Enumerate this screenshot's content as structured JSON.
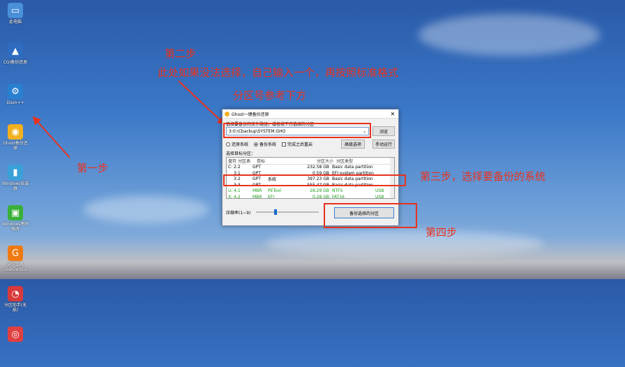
{
  "desktop_icons": [
    {
      "label": "此电脑",
      "icon": "computer-icon",
      "color": "#4a90d9"
    },
    {
      "label": "CGI备份还原",
      "icon": "cgi-icon",
      "color": "#2d6cc0"
    },
    {
      "label": "Dism++",
      "icon": "gear-icon",
      "color": "#2a80d0"
    },
    {
      "label": "Ghost备份还原",
      "icon": "ghost-icon",
      "color": "#f2b01e"
    },
    {
      "label": "Windows安装器",
      "icon": "installer-icon",
      "color": "#3aa0d8"
    },
    {
      "label": "Windows密码修改",
      "icon": "lock-icon",
      "color": "#3ab03a"
    },
    {
      "label": "分区工具DiskGenius",
      "icon": "diskgenius-icon",
      "color": "#f07a10"
    },
    {
      "label": "分区助手(无损)",
      "icon": "partition-icon",
      "color": "#d83a3a"
    },
    {
      "label": "",
      "icon": "lifebuoy-icon",
      "color": "#e04040"
    }
  ],
  "annotations": {
    "step2": "第二步",
    "step2_line1": "此处如果没法选择，自己输入一个，再按照标准格式",
    "step2_line2": "分区号参考下方",
    "step1": "第一步",
    "step3": "第三步，选择要备份的系统",
    "step4": "第四步"
  },
  "dialog": {
    "title": "Ghost一键备份还原",
    "path_label": "选择要备份的文件路径，或者按下方选择的分区",
    "path_value": "3:0:\\Cbackup\\SYSTEM.GHO",
    "browse": "浏览",
    "radio_restore": "还原系统",
    "radio_backup": "备份系统",
    "checkbox_reboot": "完成之后重启",
    "advanced": "高级选项",
    "manual": "手动运行",
    "target_label": "选择目标分区：",
    "columns": [
      "盘符",
      "分区表",
      "卷标",
      "",
      "分区大小",
      "分区类型",
      ""
    ],
    "rows": [
      {
        "drive": "C:",
        "part": "2:2",
        "table": "GPT",
        "label": "",
        "size": "232.58 GB",
        "type": "Basic data partition",
        "bus": "",
        "green": false
      },
      {
        "drive": "",
        "part": "3:1",
        "table": "GPT",
        "label": "",
        "size": "0.59 GB",
        "type": "EFI system partition",
        "bus": "",
        "green": false
      },
      {
        "drive": "",
        "part": "3:2",
        "table": "GPT",
        "label": "系统",
        "size": "397.23 GB",
        "type": "Basic data partition",
        "bus": "",
        "green": false
      },
      {
        "drive": "",
        "part": "3:3",
        "table": "GPT",
        "label": "",
        "size": "555.47 GB",
        "type": "Basic data partition",
        "bus": "",
        "green": false
      },
      {
        "drive": "U:",
        "part": "4:1",
        "table": "MBR",
        "label": "PETool",
        "size": "28.29 GB",
        "type": "NTFS",
        "bus": "USB",
        "green": true
      },
      {
        "drive": "X:",
        "part": "4:2",
        "table": "MBR",
        "label": "EFI",
        "size": "0.28 GB",
        "type": "FAT16",
        "bus": "USB",
        "green": true
      }
    ],
    "compress_label": "压缩率(1~9)",
    "compress_level": 0.3,
    "backup_button": "备份选择的分区"
  }
}
